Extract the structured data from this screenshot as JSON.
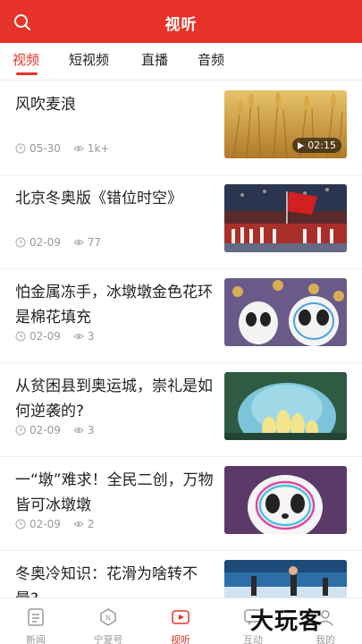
{
  "header": {
    "title": "视听"
  },
  "tabs": [
    {
      "label": "视频",
      "active": true
    },
    {
      "label": "短视频",
      "active": false
    },
    {
      "label": "直播",
      "active": false
    },
    {
      "label": "音频",
      "active": false
    }
  ],
  "items": [
    {
      "title": "风吹麦浪",
      "date": "05-30",
      "views": "1k+",
      "duration": "02:15",
      "thumb": "wheat-field"
    },
    {
      "title": "北京冬奥版《错位时空》",
      "date": "02-09",
      "views": "77",
      "thumb": "olympic-flag-ceremony"
    },
    {
      "title": "怕金属冻手，冰墩墩金色花环是棉花填充",
      "date": "02-09",
      "views": "3",
      "thumb": "bing-dwen-dwen-mascots"
    },
    {
      "title": "从贫困县到奥运城，崇礼是如何逆袭的?",
      "date": "02-09",
      "views": "3",
      "thumb": "chongli-landscape"
    },
    {
      "title": "一“墩”难求！全民二创，万物皆可冰墩墩",
      "date": "02-09",
      "views": "2",
      "thumb": "bing-dwen-dwen-closeup"
    },
    {
      "title": "冬奥冷知识：花滑为啥转不晕?",
      "thumb": "figure-skating"
    }
  ],
  "tabbar": [
    {
      "label": "新闻",
      "icon": "news-icon",
      "active": false
    },
    {
      "label": "宁夏号",
      "icon": "ningxia-icon",
      "active": false
    },
    {
      "label": "视听",
      "icon": "video-icon",
      "active": true
    },
    {
      "label": "互动",
      "icon": "interact-icon",
      "active": false
    },
    {
      "label": "我的",
      "icon": "profile-icon",
      "active": false
    }
  ],
  "watermark": "大玩客",
  "colors": {
    "accent": "#e63228",
    "muted": "#999999"
  }
}
